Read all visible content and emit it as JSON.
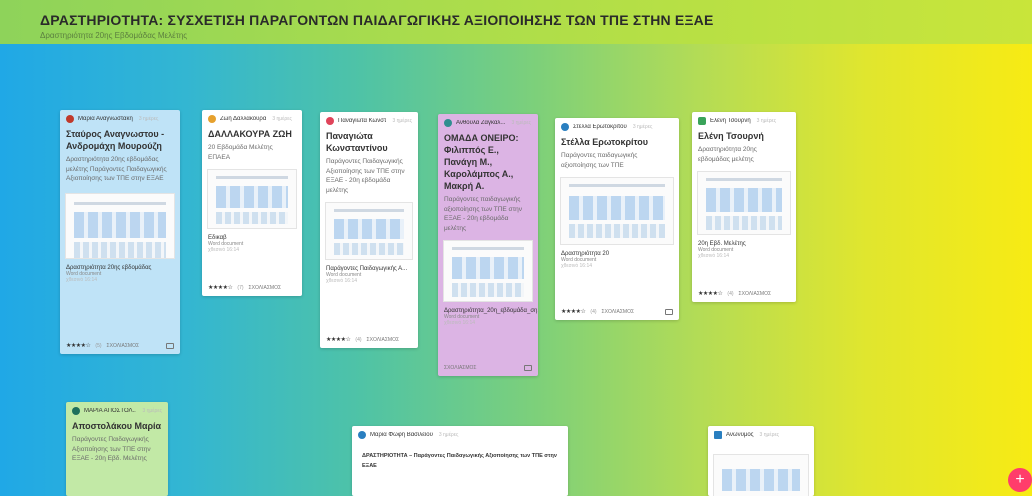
{
  "header": {
    "title": "ΔΡΑΣΤΗΡΙΟΤΗΤΑ: ΣΥΣΧΕΤΙΣΗ ΠΑΡΑΓΟΝΤΩΝ ΠΑΙΔΑΓΩΓΙΚΗΣ ΑΞΙΟΠΟΙΗΣΗΣ ΤΩΝ ΤΠΕ ΣΤΗΝ ΕΞΑΕ",
    "subtitle": "Δραστηριότητα 20ης Εβδομάδας Μελέτης"
  },
  "cards": [
    {
      "author": "Μαρία Αναγνωστάκη",
      "time": "3 ημέρες",
      "avatar_color": "#c0392b",
      "title": "Σταύρος Αναγνωστου - Ανδρομάχη Μουρούζη",
      "body": "Δραστηριότητα 20ης εβδομάδας μελέτης Παράγοντες Παιδαγωγικής Αξιοποίησης των ΤΠΕ στην ΕΞΑΕ",
      "file": "Δραστηριότητα 20ης εβδομάδας",
      "file_type": "Word document",
      "file_date": "χθεσινό 16:14",
      "rating": "★★★★☆",
      "reactions": "(5)",
      "comments": "ΣΧΟΛΙΑΣΜΟΣ"
    },
    {
      "author": "Ζωή Δαλλάκουρα",
      "time": "3 ημέρες",
      "avatar_color": "#e6a12e",
      "title": "ΔΑΛΛΑΚΟΥΡΑ ΖΩΗ",
      "body": "20 Εβδομάδα Μελέτης ΕΠΑΕΑ",
      "file": "Εδικαβ",
      "file_type": "Word document",
      "file_date": "χθεσινό 16:14",
      "rating": "★★★★☆",
      "reactions": "(7)",
      "comments": "ΣΧΟΛΙΑΣΜΟΣ"
    },
    {
      "author": "Παναγιώτα Κωνσταντ...",
      "time": "3 ημέρες",
      "avatar_color": "#e0445a",
      "title": "Παναγιώτα Κωνσταντίνου",
      "body": "Παράγοντες Παιδαγωγικής Αξιοποίησης των ΤΠΕ στην ΕΞΑΕ - 20η εβδομάδα μελέτης",
      "file": "Παράγοντες Παιδαγωγικής Α...",
      "file_type": "Word document",
      "file_date": "χθεσινό 16:14",
      "rating": "★★★★☆",
      "reactions": "(4)",
      "comments": "ΣΧΟΛΙΑΣΜΟΣ"
    },
    {
      "author": "Ανθούλα Ζαγκαλ...",
      "time": "3 ημέρες",
      "avatar_color": "#2f8e8f",
      "title": "ΟΜΑΔΑ ΟΝΕΙΡΟ: Φιλιππός Ε., Πανάγη Μ., Καρολάμπος Α., Μακρή Α.",
      "body": "Παράγοντες παιδαγωγικής αξιοποίησης των ΤΠΕ στην ΕΞΑΕ - 20η εβδομάδα μελέτης",
      "file": "Δραστηριότητα_20η_εβδομάδα_ση...",
      "file_type": "Word document",
      "file_date": "χθεσινό 16:14",
      "rating": "",
      "reactions": "",
      "comments": "ΣΧΟΛΙΑΣΜΟΣ"
    },
    {
      "author": "Στέλλα Ερωτοκρίτου",
      "time": "3 ημέρες",
      "avatar_color": "#2a7fc0",
      "title": "Στέλλα Ερωτοκρίτου",
      "body": "Παράγοντες παιδαγωγικής αξιοποίησης των ΤΠΕ",
      "file": "Δραστηριότητα 20",
      "file_type": "Word document",
      "file_date": "χθεσινό 16:14",
      "rating": "★★★★☆",
      "reactions": "(4)",
      "comments": "ΣΧΟΛΙΑΣΜΟΣ"
    },
    {
      "author": "Ελένη Τσουρνή",
      "time": "3 ημέρες",
      "avatar_color": "#3aa35a",
      "title": "Ελένη Τσουρνή",
      "body": "Δραστηριότητα 20ης εβδομάδας μελέτης",
      "file": "20η Εβδ. Μελέτης",
      "file_type": "Word document",
      "file_date": "χθεσινό 16:14",
      "rating": "★★★★☆",
      "reactions": "(4)",
      "comments": "ΣΧΟΛΙΑΣΜΟΣ"
    },
    {
      "author": "ΜΑΡΙΑ ΑΠΟΣΤΟΛ...",
      "time": "3 ημέρες",
      "avatar_color": "#1e6f5c",
      "title": "Αποστολάκου Μαρία",
      "body": "Παράγοντες Παιδαγωγικής Αξιοποίησης των ΤΠΕ στην ΕΞΑΕ - 20η Εβδ. Μελέτης"
    },
    {
      "author": "Μαρία Φώφη Βασιλείου",
      "time": "3 ημέρες",
      "avatar_color": "#2a7fc0",
      "doc_title": "ΔΡΑΣΤΗΡΙΟΤΗΤΑ – Παράγοντες Παιδαγωγικής Αξιοποίησης των ΤΠΕ στην ΕΞΑΕ"
    },
    {
      "author": "Ανώνυμος",
      "time": "3 ημέρες",
      "avatar_color": "#2a7fc0"
    }
  ],
  "fab": {
    "label": "+"
  }
}
